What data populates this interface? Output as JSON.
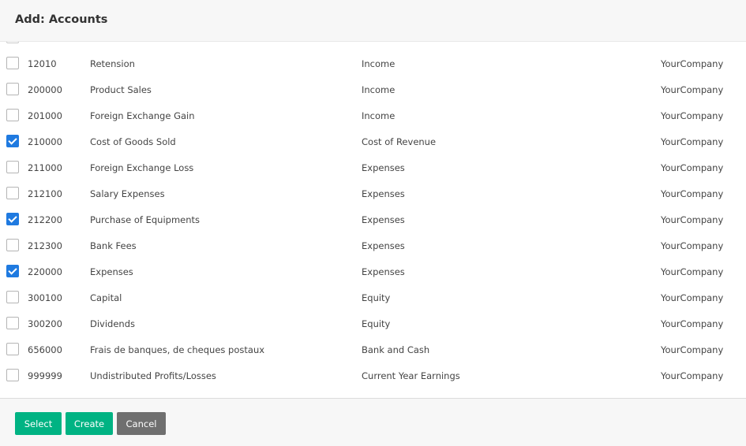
{
  "dialog": {
    "title": "Add: Accounts"
  },
  "accounts": [
    {
      "code": "12010",
      "name": "Retension",
      "type": "Income",
      "company": "YourCompany",
      "checked": false
    },
    {
      "code": "200000",
      "name": "Product Sales",
      "type": "Income",
      "company": "YourCompany",
      "checked": false
    },
    {
      "code": "201000",
      "name": "Foreign Exchange Gain",
      "type": "Income",
      "company": "YourCompany",
      "checked": false
    },
    {
      "code": "210000",
      "name": "Cost of Goods Sold",
      "type": "Cost of Revenue",
      "company": "YourCompany",
      "checked": true
    },
    {
      "code": "211000",
      "name": "Foreign Exchange Loss",
      "type": "Expenses",
      "company": "YourCompany",
      "checked": false
    },
    {
      "code": "212100",
      "name": "Salary Expenses",
      "type": "Expenses",
      "company": "YourCompany",
      "checked": false
    },
    {
      "code": "212200",
      "name": "Purchase of Equipments",
      "type": "Expenses",
      "company": "YourCompany",
      "checked": true
    },
    {
      "code": "212300",
      "name": "Bank Fees",
      "type": "Expenses",
      "company": "YourCompany",
      "checked": false
    },
    {
      "code": "220000",
      "name": "Expenses",
      "type": "Expenses",
      "company": "YourCompany",
      "checked": true
    },
    {
      "code": "300100",
      "name": "Capital",
      "type": "Equity",
      "company": "YourCompany",
      "checked": false
    },
    {
      "code": "300200",
      "name": "Dividends",
      "type": "Equity",
      "company": "YourCompany",
      "checked": false
    },
    {
      "code": "656000",
      "name": "Frais de banques, de cheques postaux",
      "type": "Bank and Cash",
      "company": "YourCompany",
      "checked": false
    },
    {
      "code": "999999",
      "name": "Undistributed Profits/Losses",
      "type": "Current Year Earnings",
      "company": "YourCompany",
      "checked": false
    }
  ],
  "footer": {
    "select_label": "Select",
    "create_label": "Create",
    "cancel_label": "Cancel"
  },
  "colors": {
    "primary_button": "#00b383",
    "secondary_button": "#6f6f6f",
    "checkbox_checked": "#1f7ae0"
  }
}
